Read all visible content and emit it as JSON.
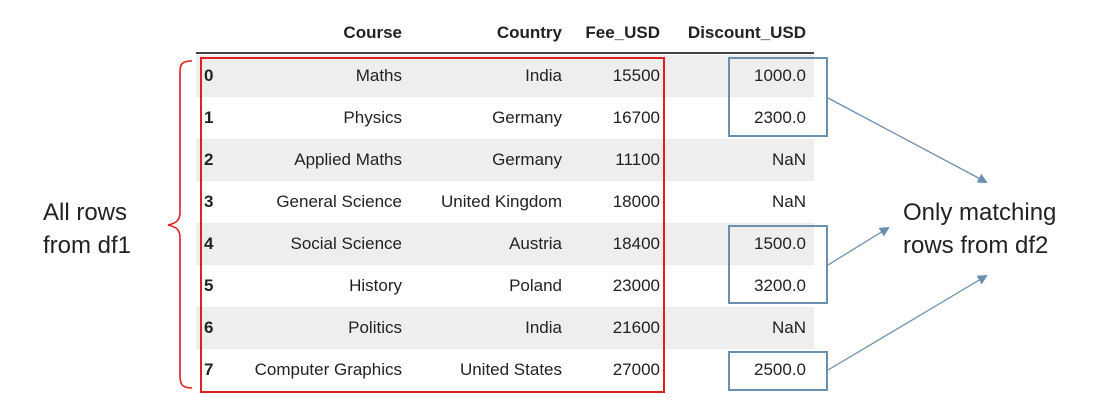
{
  "table": {
    "columns": [
      "Course",
      "Country",
      "Fee_USD",
      "Discount_USD"
    ],
    "rows": [
      {
        "index": "0",
        "course": "Maths",
        "country": "India",
        "fee": "15500",
        "discount": "1000.0",
        "matched": true
      },
      {
        "index": "1",
        "course": "Physics",
        "country": "Germany",
        "fee": "16700",
        "discount": "2300.0",
        "matched": true
      },
      {
        "index": "2",
        "course": "Applied Maths",
        "country": "Germany",
        "fee": "11100",
        "discount": "NaN",
        "matched": false
      },
      {
        "index": "3",
        "course": "General Science",
        "country": "United Kingdom",
        "fee": "18000",
        "discount": "NaN",
        "matched": false
      },
      {
        "index": "4",
        "course": "Social Science",
        "country": "Austria",
        "fee": "18400",
        "discount": "1500.0",
        "matched": true
      },
      {
        "index": "5",
        "course": "History",
        "country": "Poland",
        "fee": "23000",
        "discount": "3200.0",
        "matched": true
      },
      {
        "index": "6",
        "course": "Politics",
        "country": "India",
        "fee": "21600",
        "discount": "NaN",
        "matched": false
      },
      {
        "index": "7",
        "course": "Computer Graphics",
        "country": "United States",
        "fee": "27000",
        "discount": "2500.0",
        "matched": true
      }
    ]
  },
  "annotations": {
    "left_label_line1": "All rows",
    "left_label_line2": "from df1",
    "right_label_line1": "Only matching",
    "right_label_line2": "rows from df2"
  },
  "colors": {
    "df1_box": "#e02020",
    "df2_box": "#6b8fae",
    "arrow": "#6b8fae",
    "brace": "#e02020"
  }
}
